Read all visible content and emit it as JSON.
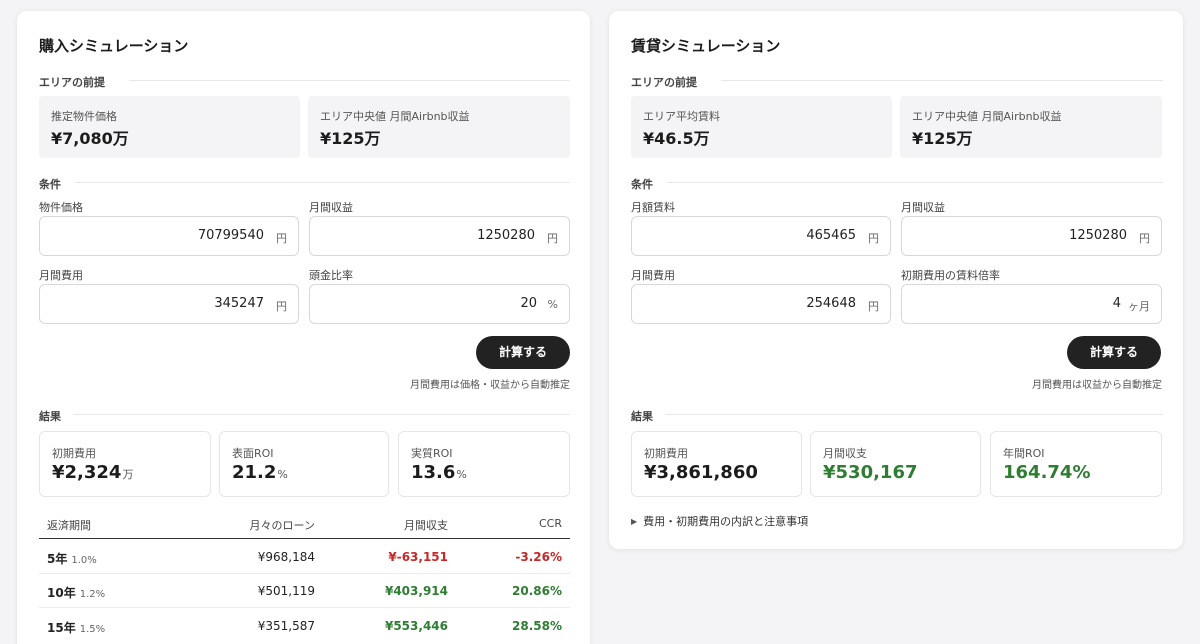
{
  "buy": {
    "title": "購入シミュレーション",
    "premise_label": "エリアの前提",
    "premise": [
      {
        "label": "推定物件価格",
        "value": "¥7,080万"
      },
      {
        "label": "エリア中央値 月間Airbnb収益",
        "value": "¥125万"
      }
    ],
    "conditions_label": "条件",
    "fields": [
      {
        "label": "物件価格",
        "value": "70799540",
        "unit": "円"
      },
      {
        "label": "月間収益",
        "value": "1250280",
        "unit": "円"
      },
      {
        "label": "月間費用",
        "value": "345247",
        "unit": "円"
      },
      {
        "label": "頭金比率",
        "value": "20",
        "unit": "%"
      }
    ],
    "calc_button": "計算する",
    "note": "月間費用は価格・収益から自動推定",
    "results_label": "結果",
    "results": [
      {
        "label": "初期費用",
        "value": "¥2,324",
        "unit": "万"
      },
      {
        "label": "表面ROI",
        "value": "21.2",
        "unit": "%"
      },
      {
        "label": "実質ROI",
        "value": "13.6",
        "unit": "%"
      }
    ],
    "table": {
      "headers": [
        "返済期間",
        "月々のローン",
        "月間収支",
        "CCR"
      ],
      "rows": [
        {
          "term": "5年",
          "rate": "1.0%",
          "loan": "¥968,184",
          "balance": "¥-63,151",
          "ccr": "-3.26%",
          "status": "negative"
        },
        {
          "term": "10年",
          "rate": "1.2%",
          "loan": "¥501,119",
          "balance": "¥403,914",
          "ccr": "20.86%",
          "status": "positive"
        },
        {
          "term": "15年",
          "rate": "1.5%",
          "loan": "¥351,587",
          "balance": "¥553,446",
          "ccr": "28.58%",
          "status": "positive"
        }
      ]
    }
  },
  "rent": {
    "title": "賃貸シミュレーション",
    "premise_label": "エリアの前提",
    "premise": [
      {
        "label": "エリア平均賃料",
        "value": "¥46.5万"
      },
      {
        "label": "エリア中央値 月間Airbnb収益",
        "value": "¥125万"
      }
    ],
    "conditions_label": "条件",
    "fields": [
      {
        "label": "月額賃料",
        "value": "465465",
        "unit": "円"
      },
      {
        "label": "月間収益",
        "value": "1250280",
        "unit": "円"
      },
      {
        "label": "月間費用",
        "value": "254648",
        "unit": "円"
      },
      {
        "label": "初期費用の賃料倍率",
        "value": "4",
        "unit": "ヶ月"
      }
    ],
    "calc_button": "計算する",
    "note": "月間費用は収益から自動推定",
    "results_label": "結果",
    "results": [
      {
        "label": "初期費用",
        "value": "¥3,861,860"
      },
      {
        "label": "月間収支",
        "value": "¥530,167"
      },
      {
        "label": "年間ROI",
        "value": "164.74%"
      }
    ],
    "disclosure": "費用・初期費用の内訳と注意事項"
  },
  "colors": {
    "positive": "#2e7d32",
    "negative": "#c62828",
    "button": "#222222"
  }
}
